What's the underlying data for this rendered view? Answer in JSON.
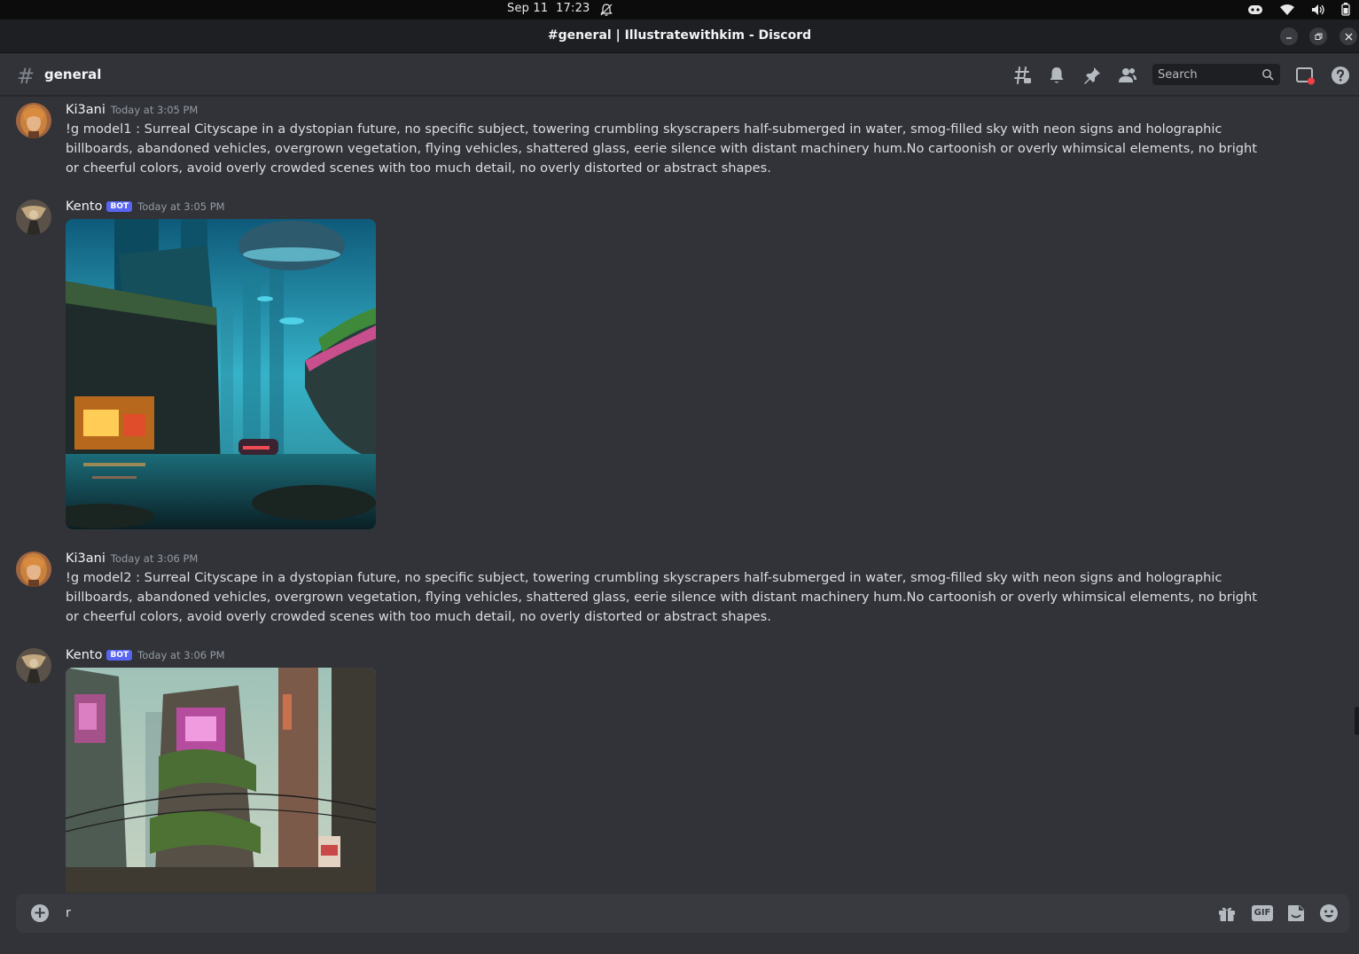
{
  "os": {
    "date": "Sep 11",
    "time": "17:23"
  },
  "window": {
    "title": "#general | Illustratewithkim - Discord"
  },
  "channel": {
    "hash": "#",
    "name": "general",
    "search_placeholder": "Search"
  },
  "messages": [
    {
      "author": "Ki3ani",
      "bot": false,
      "timestamp": "Today at 3:05 PM",
      "text": "!g model1 : Surreal Cityscape in a dystopian future, no specific subject, towering crumbling skyscrapers half-submerged in water, smog-filled sky with neon signs and holographic billboards, abandoned vehicles, overgrown vegetation, flying vehicles, shattered glass, eerie silence with distant machinery hum.No cartoonish or overly whimsical elements, no bright or cheerful colors, avoid overly crowded scenes with too much detail, no overly distorted or abstract shapes."
    },
    {
      "author": "Kento",
      "bot": true,
      "badge": "BOT",
      "timestamp": "Today at 3:05 PM",
      "attachment": "flooded-neon-city-image"
    },
    {
      "author": "Ki3ani",
      "bot": false,
      "timestamp": "Today at 3:06 PM",
      "text": "!g model2 : Surreal Cityscape in a dystopian future, no specific subject, towering crumbling skyscrapers half-submerged in water, smog-filled sky with neon signs and holographic billboards, abandoned vehicles, overgrown vegetation, flying vehicles, shattered glass, eerie silence with distant machinery hum.No cartoonish or overly whimsical elements, no bright or cheerful colors, avoid overly crowded scenes with too much detail, no overly distorted or abstract shapes."
    },
    {
      "author": "Kento",
      "bot": true,
      "badge": "BOT",
      "timestamp": "Today at 3:06 PM",
      "attachment": "overgrown-ruined-city-image"
    }
  ],
  "composer": {
    "value": "r",
    "gif_label": "GIF"
  },
  "colors": {
    "background": "#313338",
    "accent": "#5865f2",
    "composer": "#383a40"
  }
}
